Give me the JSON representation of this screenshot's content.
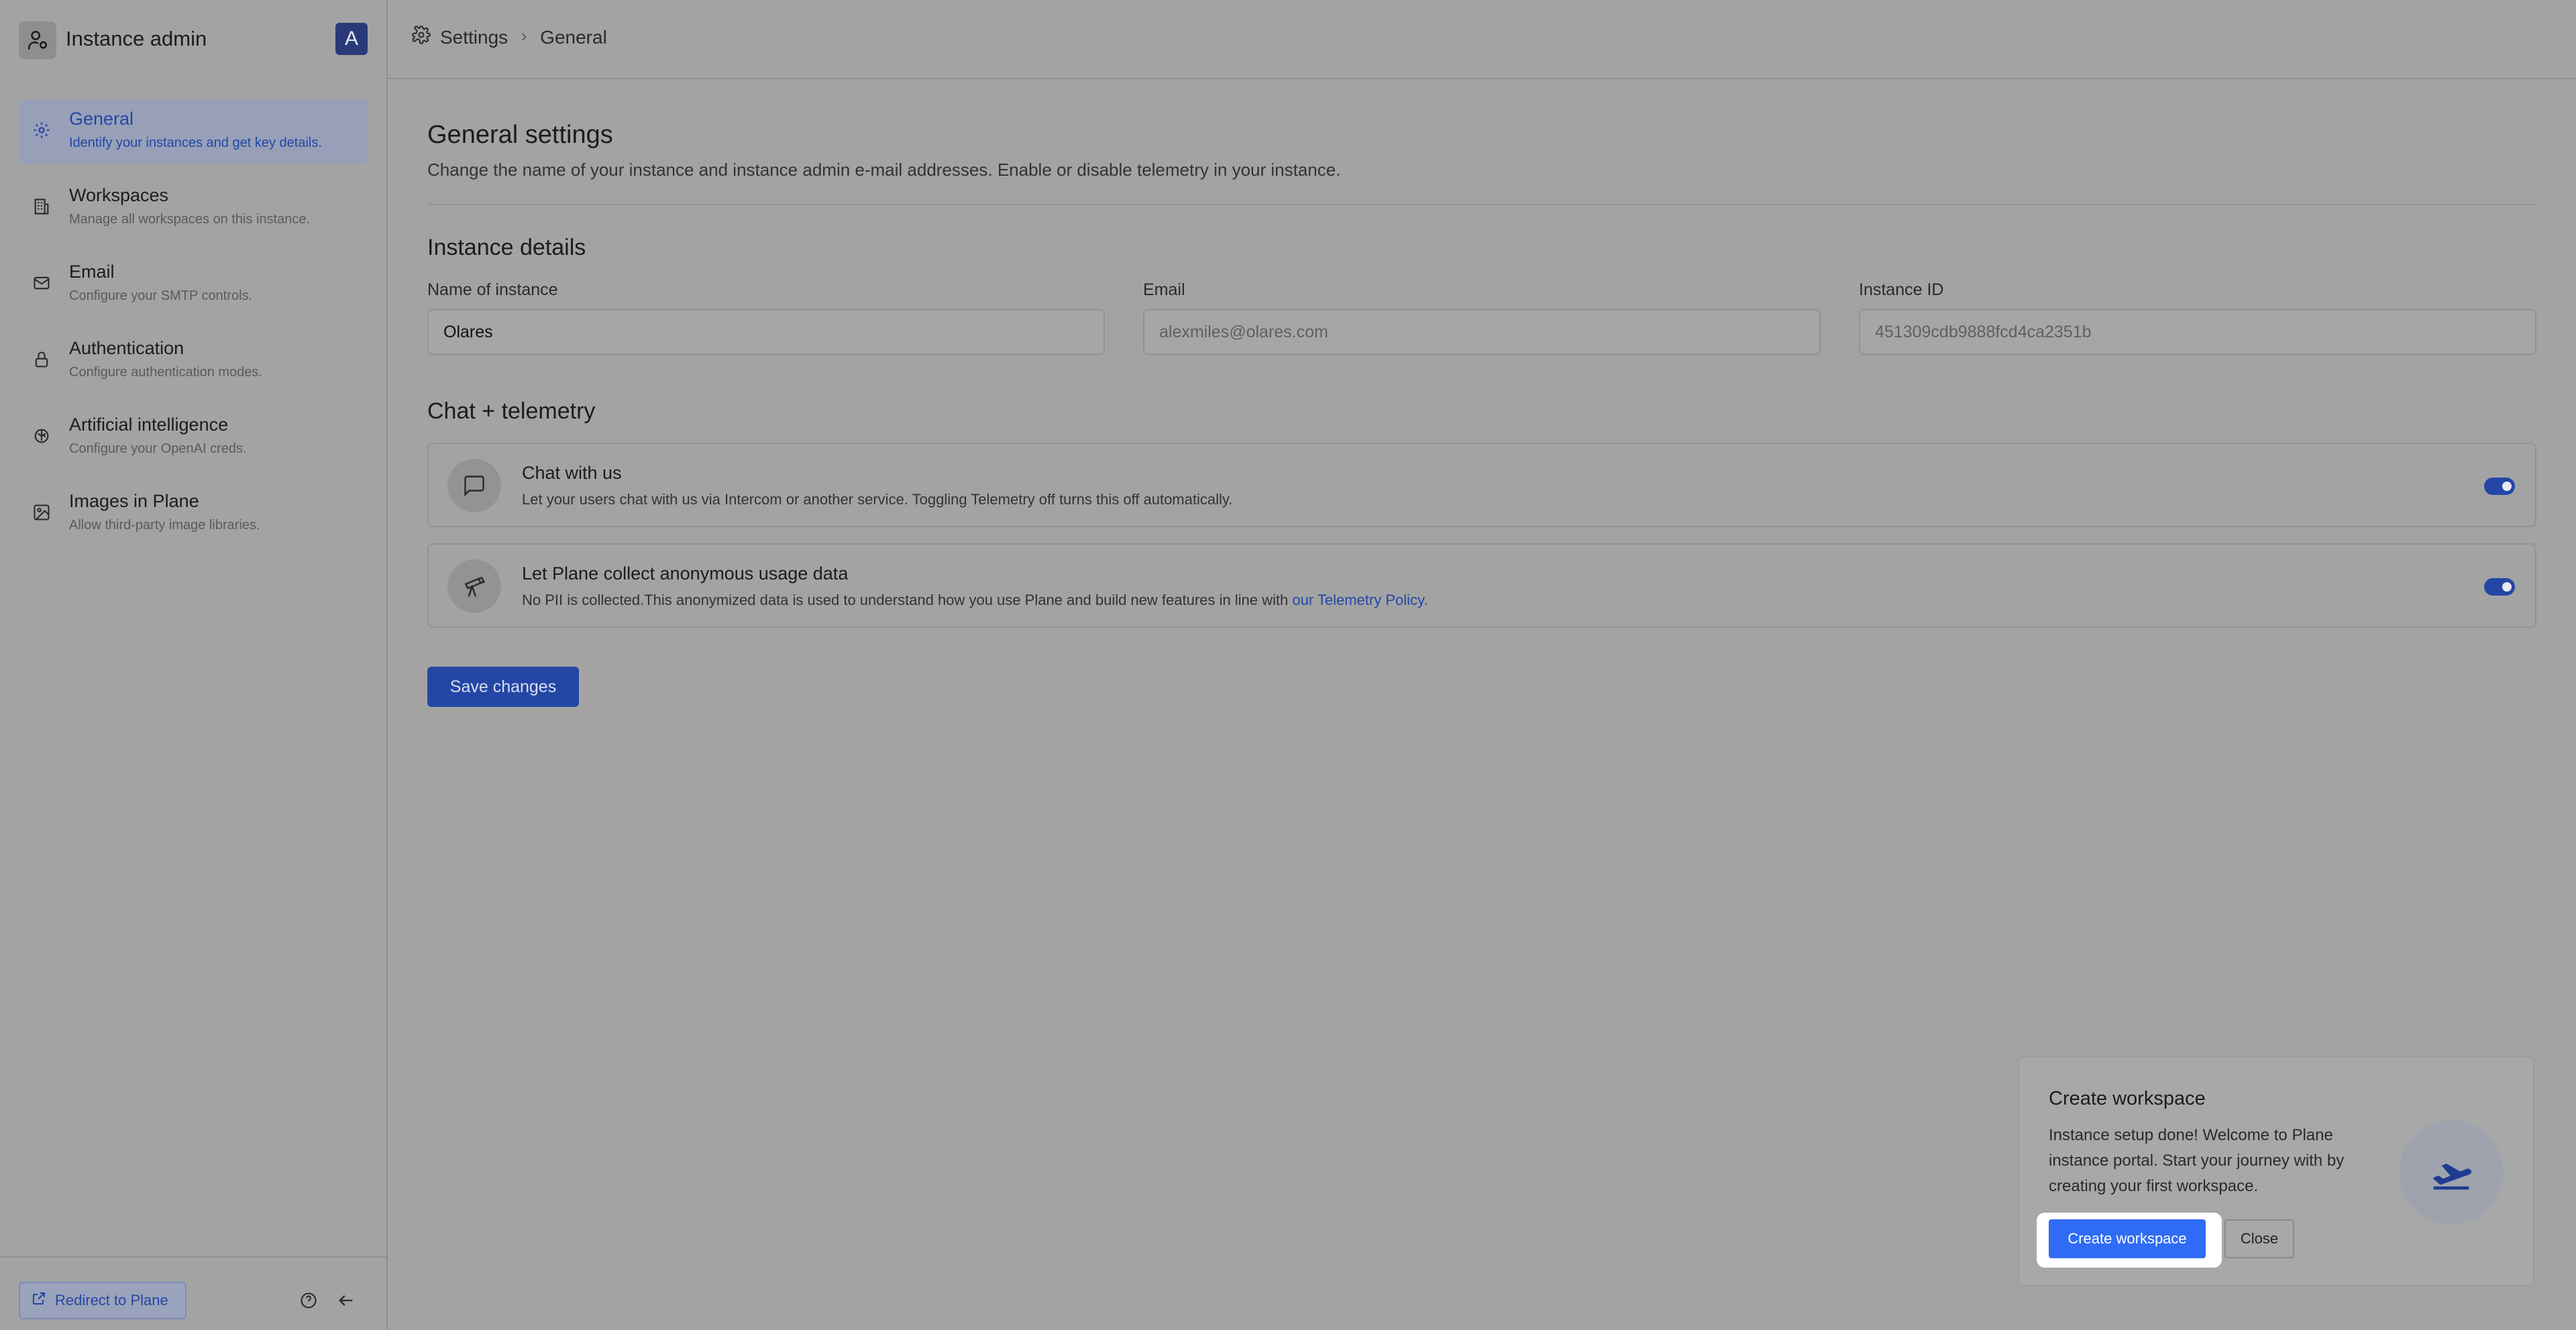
{
  "sidebar": {
    "title": "Instance admin",
    "avatar_letter": "A",
    "items": [
      {
        "label": "General",
        "description": "Identify your instances and get key details.",
        "icon": "gear-icon",
        "active": true
      },
      {
        "label": "Workspaces",
        "description": "Manage all workspaces on this instance.",
        "icon": "building-icon",
        "active": false
      },
      {
        "label": "Email",
        "description": "Configure your SMTP controls.",
        "icon": "mail-icon",
        "active": false
      },
      {
        "label": "Authentication",
        "description": "Configure authentication modes.",
        "icon": "lock-icon",
        "active": false
      },
      {
        "label": "Artificial intelligence",
        "description": "Configure your OpenAI creds.",
        "icon": "openai-icon",
        "active": false
      },
      {
        "label": "Images in Plane",
        "description": "Allow third-party image libraries.",
        "icon": "image-icon",
        "active": false
      }
    ],
    "footer": {
      "redirect_label": "Redirect to Plane"
    }
  },
  "breadcrumb": {
    "root": "Settings",
    "current": "General"
  },
  "page": {
    "title": "General settings",
    "description": "Change the name of your instance and instance admin e-mail addresses. Enable or disable telemetry in your instance."
  },
  "instance_details": {
    "heading": "Instance details",
    "fields": [
      {
        "label": "Name of instance",
        "value": "Olares"
      },
      {
        "label": "Email",
        "value": "alexmiles@olares.com"
      },
      {
        "label": "Instance ID",
        "value": "451309cdb9888fcd4ca2351b"
      }
    ]
  },
  "telemetry": {
    "heading": "Chat + telemetry",
    "cards": [
      {
        "title": "Chat with us",
        "description": "Let your users chat with us via Intercom or another service. Toggling Telemetry off turns this off automatically.",
        "link": "",
        "enabled": true
      },
      {
        "title": "Let Plane collect anonymous usage data",
        "description": "No PII is collected.This anonymized data is used to understand how you use Plane and build new features in line with ",
        "link": "our Telemetry Policy.",
        "enabled": true
      }
    ]
  },
  "save_label": "Save changes",
  "popup": {
    "title": "Create workspace",
    "body": "Instance setup done! Welcome to Plane instance portal. Start your journey with by creating your first workspace.",
    "create_label": "Create workspace",
    "close_label": "Close"
  },
  "colors": {
    "accent": "#2447a6",
    "primary_button": "#2f6cf6",
    "overlay": "#a3a3a3"
  }
}
